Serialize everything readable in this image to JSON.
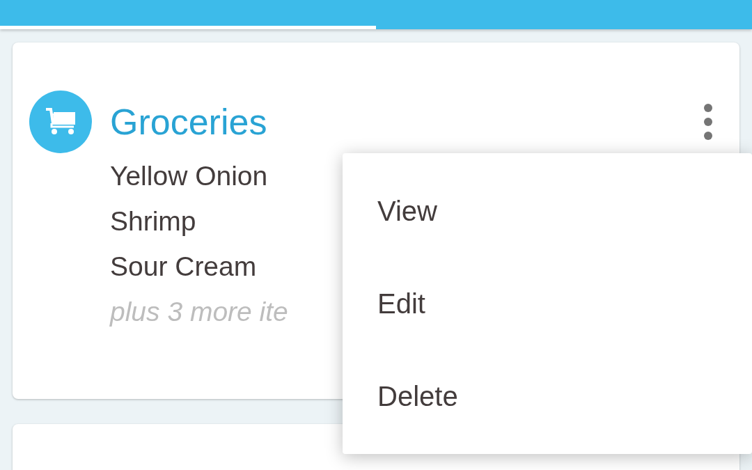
{
  "tabs": [
    {
      "selected": true
    },
    {
      "selected": false
    }
  ],
  "cards": [
    {
      "kind": "list",
      "title": "Groceries",
      "items": [
        "Yellow Onion",
        "Shrimp",
        "Sour Cream"
      ],
      "more": "plus 3 more ite"
    },
    {
      "kind": "blank"
    }
  ],
  "menu": {
    "items": [
      "View",
      "Edit",
      "Delete"
    ]
  }
}
